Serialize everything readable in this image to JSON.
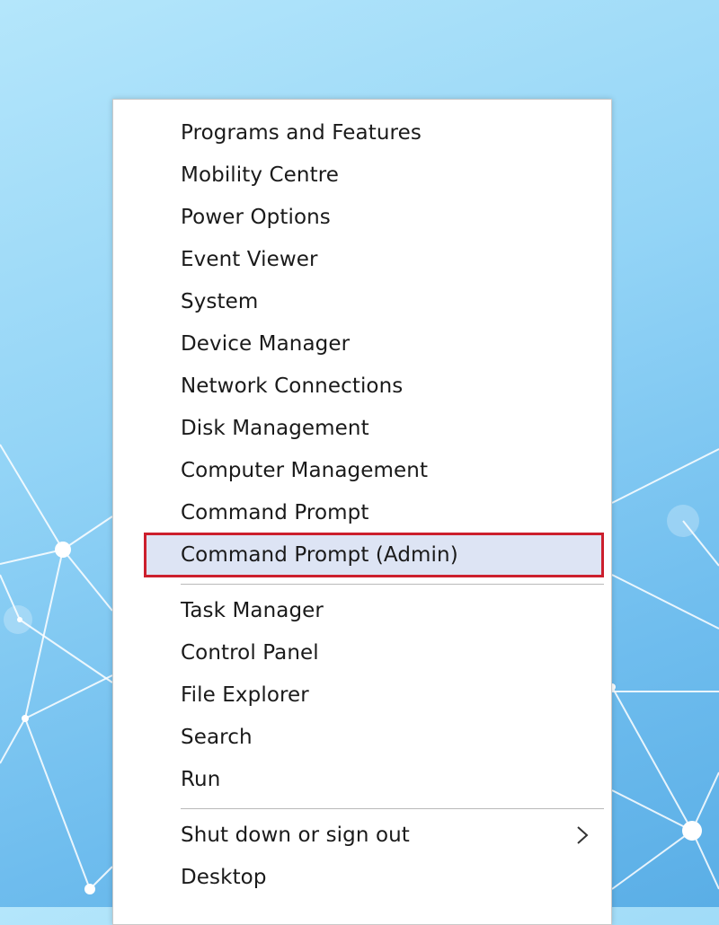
{
  "menu": {
    "group1": [
      {
        "label": "Programs and Features"
      },
      {
        "label": "Mobility Centre"
      },
      {
        "label": "Power Options"
      },
      {
        "label": "Event Viewer"
      },
      {
        "label": "System"
      },
      {
        "label": "Device Manager"
      },
      {
        "label": "Network Connections"
      },
      {
        "label": "Disk Management"
      },
      {
        "label": "Computer Management"
      },
      {
        "label": "Command Prompt"
      },
      {
        "label": "Command Prompt (Admin)",
        "highlighted": true
      }
    ],
    "group2": [
      {
        "label": "Task Manager"
      },
      {
        "label": "Control Panel"
      },
      {
        "label": "File Explorer"
      },
      {
        "label": "Search"
      },
      {
        "label": "Run"
      }
    ],
    "group3": [
      {
        "label": "Shut down or sign out",
        "has_submenu": true,
        "submenu_icon": "chevron-right-icon"
      },
      {
        "label": "Desktop"
      }
    ]
  },
  "colors": {
    "highlight_fill": "#dde4f4",
    "highlight_border": "#cc1f2d",
    "menu_background": "#ffffff",
    "text": "#1a1a1a"
  }
}
